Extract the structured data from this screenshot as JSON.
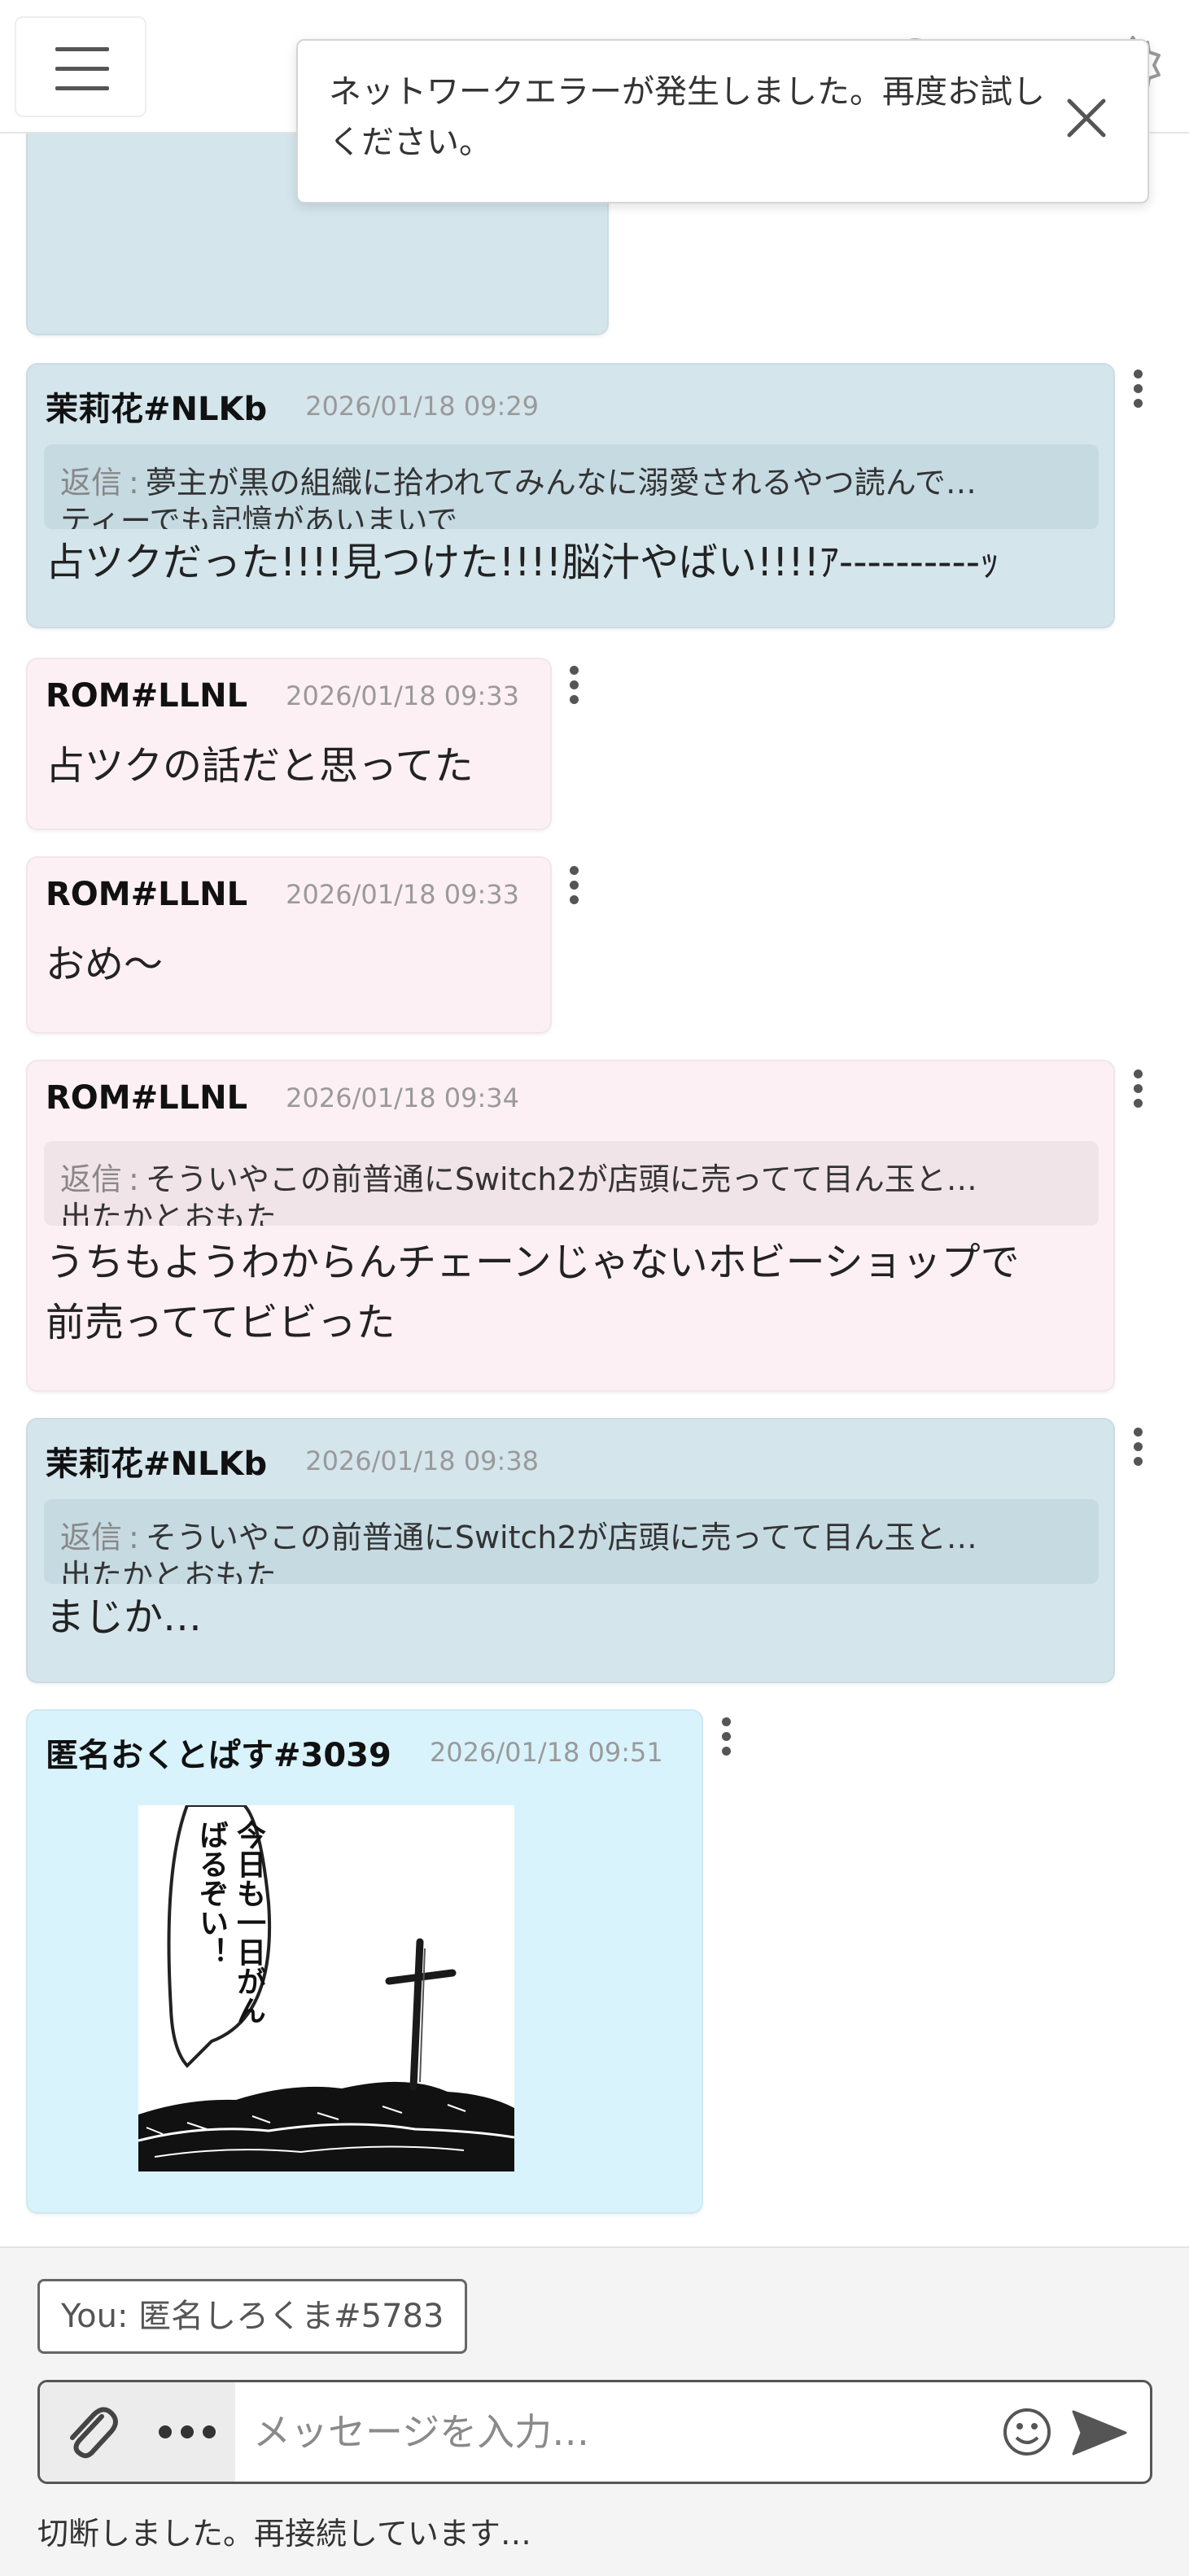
{
  "toast": {
    "message": "ネットワークエラーが発生しました。再度お試しください。"
  },
  "messages": [
    {
      "author": "茉莉花#NLKb",
      "timestamp": "2026/01/18 09:29",
      "reply_label": "返信",
      "reply_text": "夢主が黒の組織に拾われてみんなに溺愛されるやつ読んで…",
      "reply_line2": "ティーでも記憶があいまいで",
      "body": "占ツクだった!!!!見つけた!!!!脳汁やばい!!!!ｱ‐‐‐‐‐‐‐‐‐‐ｯ"
    },
    {
      "author": "ROM#LLNL",
      "timestamp": "2026/01/18 09:33",
      "body": "占ツクの話だと思ってた"
    },
    {
      "author": "ROM#LLNL",
      "timestamp": "2026/01/18 09:33",
      "body": "おめ〜"
    },
    {
      "author": "ROM#LLNL",
      "timestamp": "2026/01/18 09:34",
      "reply_label": "返信",
      "reply_text": "そういやこの前普通にSwitch2が店頭に売ってて目ん玉と…",
      "reply_line2": "出たかとおもた",
      "body_line1": "うちもようわからんチェーンじゃないホビーショップで",
      "body_line2": "前売っててビビった"
    },
    {
      "author": "茉莉花#NLKb",
      "timestamp": "2026/01/18 09:38",
      "reply_label": "返信",
      "reply_text": "そういやこの前普通にSwitch2が店頭に売ってて目ん玉と…",
      "reply_line2": "出たかとおもた",
      "body": "まじか…"
    },
    {
      "author": "匿名おくとぱす#3039",
      "timestamp": "2026/01/18 09:51",
      "image_text": "今日も一日がんばるぞい！"
    }
  ],
  "composer": {
    "you_label": "You: 匿名しろくま#5783",
    "placeholder": "メッセージを入力…",
    "status": "切断しました。再接続しています…"
  },
  "icons": {
    "menu": "hamburger-menu-icon",
    "user": "user-icon",
    "theme": "theme-icon",
    "search": "search-icon",
    "settings": "gear-icon",
    "close": "close-icon",
    "attach": "paperclip-icon",
    "more": "more-dots-icon",
    "emoji": "smiley-icon",
    "send": "send-icon",
    "kebab": "kebab-menu-icon"
  }
}
